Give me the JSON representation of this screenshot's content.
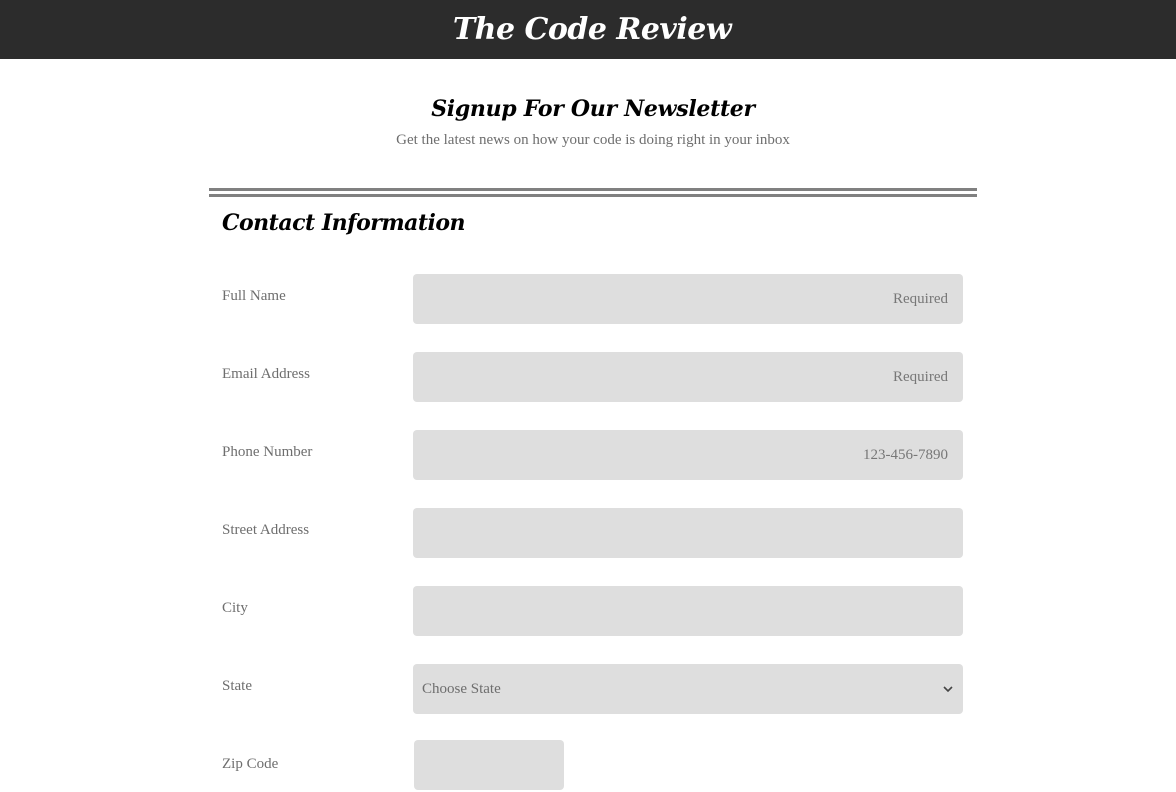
{
  "header": {
    "site_title": "The Code Review"
  },
  "intro": {
    "heading": "Signup For Our Newsletter",
    "subheading": "Get the latest news on how your code is doing right in your inbox"
  },
  "form": {
    "section_title": "Contact Information",
    "full_name": {
      "label": "Full Name",
      "placeholder": "Required",
      "value": ""
    },
    "email": {
      "label": "Email Address",
      "placeholder": "Required",
      "value": ""
    },
    "phone": {
      "label": "Phone Number",
      "placeholder": "123-456-7890",
      "value": ""
    },
    "street": {
      "label": "Street Address",
      "placeholder": "",
      "value": ""
    },
    "city": {
      "label": "City",
      "placeholder": "",
      "value": ""
    },
    "state": {
      "label": "State",
      "selected": "Choose State",
      "icon": "chevron-down-icon"
    },
    "zip": {
      "label": "Zip Code",
      "value": ""
    }
  }
}
